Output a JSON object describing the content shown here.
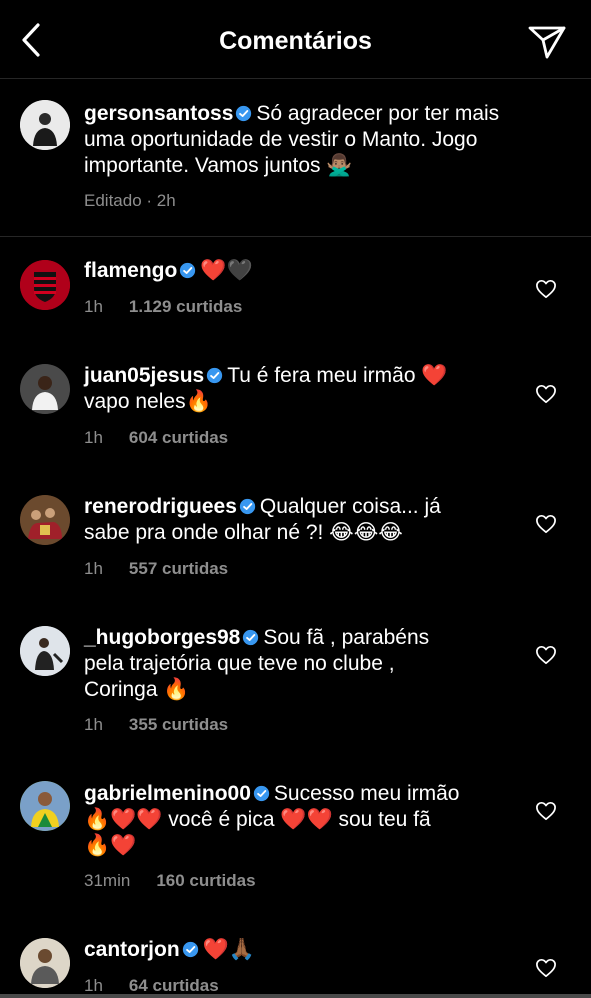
{
  "header": {
    "title": "Comentários",
    "back_icon": "chevron-left-icon",
    "send_icon": "paper-plane-icon"
  },
  "caption": {
    "username": "gersonsantoss",
    "line1": "Só agradecer por ter mais",
    "line2": "uma oportunidade de vestir o Manto. Jogo",
    "line3": "importante. Vamos juntos 🙅🏽‍♂️",
    "meta": "Editado · 2h"
  },
  "comments": [
    {
      "username": "flamengo",
      "lines": [
        "❤️🖤"
      ],
      "time": "1h",
      "likes": "1.129 curtidas"
    },
    {
      "username": "juan05jesus",
      "lines": [
        "Tu é fera meu irmão ❤️",
        "vapo neles🔥"
      ],
      "time": "1h",
      "likes": "604 curtidas"
    },
    {
      "username": "renerodriguees",
      "lines": [
        "Qualquer coisa... já",
        "sabe pra onde olhar né ?! 😂😂😂"
      ],
      "time": "1h",
      "likes": "557 curtidas"
    },
    {
      "username": "_hugoborges98",
      "lines": [
        "Sou fã , parabéns",
        "pela trajetória que teve no clube ,",
        "Coringa 🔥"
      ],
      "time": "1h",
      "likes": "355 curtidas"
    },
    {
      "username": "gabrielmenino00",
      "lines": [
        "Sucesso meu irmão",
        "🔥❤️❤️ você é pica ❤️❤️ sou teu fã",
        "🔥❤️"
      ],
      "time": "31min",
      "likes": "160 curtidas"
    },
    {
      "username": "cantorjon",
      "lines": [
        "❤️🙏🏾"
      ],
      "time": "1h",
      "likes": "64 curtidas"
    }
  ],
  "colors": {
    "background": "#000000",
    "text": "#ffffff",
    "muted": "#8e8e8e",
    "verified": "#3897f0",
    "divider": "#262626"
  }
}
